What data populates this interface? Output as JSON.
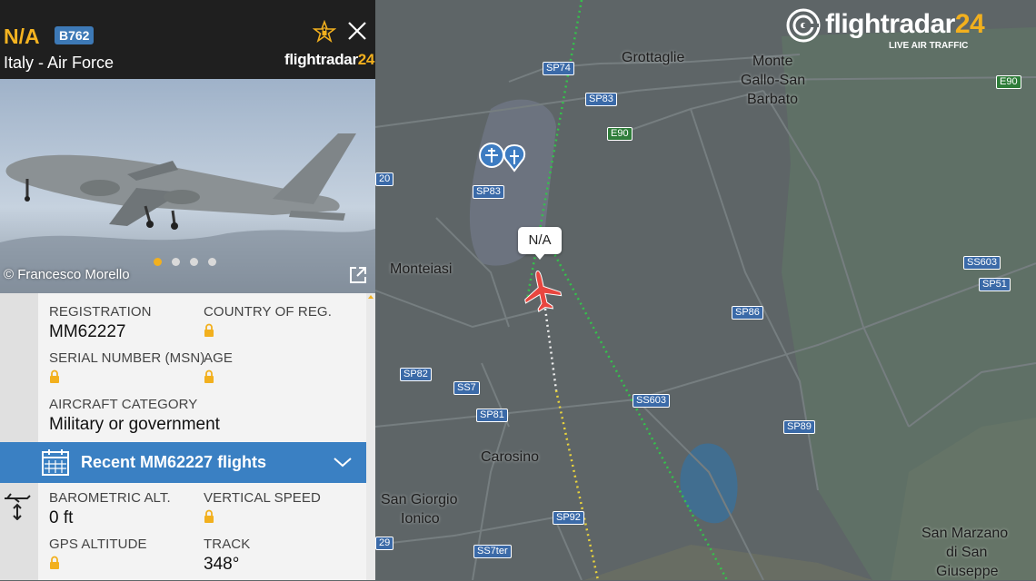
{
  "map": {
    "brand": {
      "name_main": "flightradar",
      "name_accent": "24",
      "tagline": "LIVE AIR TRAFFIC"
    },
    "aircraft_callout": "N/A",
    "places": [
      {
        "key": "grottaglie",
        "text": "Grottaglie"
      },
      {
        "key": "monte1",
        "text": "Monte"
      },
      {
        "key": "monte2",
        "text": "Gallo-San"
      },
      {
        "key": "monte3",
        "text": "Barbato"
      },
      {
        "key": "monteiasi",
        "text": "Monteiasi"
      },
      {
        "key": "carosino",
        "text": "Carosino"
      },
      {
        "key": "sangiorgio1",
        "text": "San Giorgio"
      },
      {
        "key": "sangiorgio2",
        "text": "Ionico"
      },
      {
        "key": "sanmarzano1",
        "text": "San Marzano"
      },
      {
        "key": "sanmarzano2",
        "text": "di San"
      },
      {
        "key": "sanmarzano3",
        "text": "Giuseppe"
      }
    ],
    "roads": [
      "SP74",
      "SP83",
      "E90",
      "SP83",
      "E90",
      "SP86",
      "SS603",
      "SP51",
      "SP82",
      "SS7",
      "SP81",
      "SS603",
      "SP89",
      "SP92",
      "SS7ter",
      "20",
      "29",
      "E90"
    ]
  },
  "panel": {
    "callsign": "N/A",
    "type_code": "B762",
    "airline": "Italy - Air Force",
    "logo_main": "flightradar",
    "logo_accent": "24",
    "photo_credit": "© Francesco Morello",
    "photo_dots": 4,
    "registration_label": "REGISTRATION",
    "registration_value": "MM62227",
    "country_label": "COUNTRY OF REG.",
    "serial_label": "SERIAL NUMBER (MSN)",
    "age_label": "AGE",
    "category_label": "AIRCRAFT CATEGORY",
    "category_value": "Military or government",
    "recent_flights_label": "Recent MM62227 flights",
    "baro_label": "BAROMETRIC ALT.",
    "baro_value": "0 ft",
    "vspeed_label": "VERTICAL SPEED",
    "gps_label": "GPS ALTITUDE",
    "track_label": "TRACK",
    "track_value": "348°"
  },
  "colors": {
    "accent_yellow": "#f2b01e",
    "bar_blue": "#3a80c3",
    "badge_blue": "#3d79b6",
    "plane_red": "#e9463f",
    "track_green": "#34c24b"
  }
}
